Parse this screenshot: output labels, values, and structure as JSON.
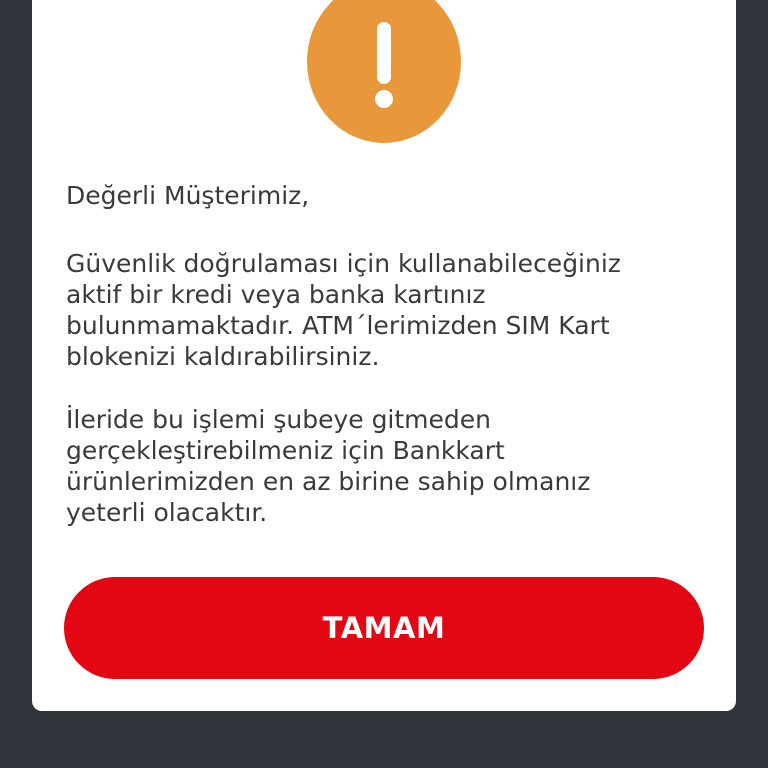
{
  "dialog": {
    "icon": "exclamation-icon",
    "icon_color": "#e8973a",
    "greeting": "Değerli Müşterimiz,",
    "paragraph1": [
      "Güvenlik doğrulaması için kullanabileceğiniz",
      "aktif bir kredi veya banka kartınız",
      "bulunmamaktadır. ATM´lerimizden SIM Kart",
      "blokenizi kaldırabilirsiniz."
    ],
    "paragraph2": [
      "İleride bu işlemi şubeye gitmeden",
      "gerçekleştirebilmeniz için Bankkart",
      "ürünlerimizden en az birine sahip olmanız",
      "yeterli olacaktır."
    ],
    "button_label": "TAMAM",
    "button_color": "#e30613"
  }
}
